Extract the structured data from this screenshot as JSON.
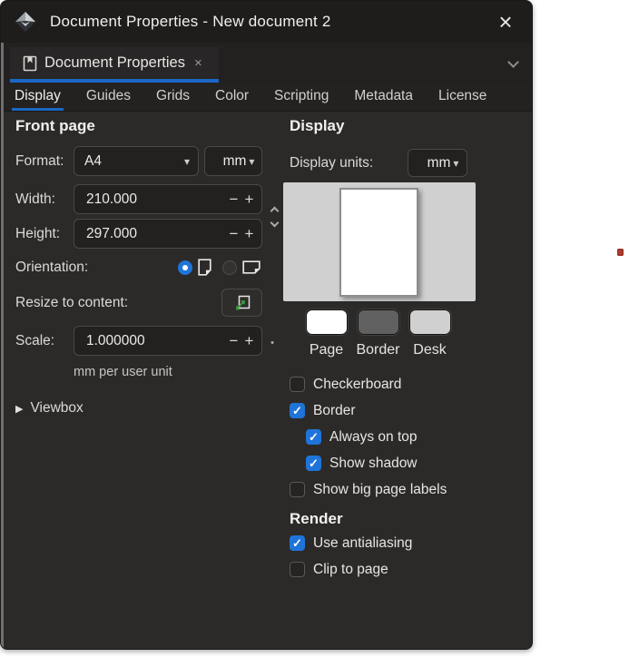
{
  "icons": {
    "window_close": "×",
    "tab_close": "×",
    "dropdown_arrow": "▾",
    "minus": "−",
    "plus": "+",
    "expander": "▶",
    "check": "✓",
    "scale_dot": "•"
  },
  "window": {
    "title": "Document Properties - New document 2"
  },
  "dock_tab": {
    "label": "Document Properties"
  },
  "tabs": [
    {
      "label": "Display",
      "active": true
    },
    {
      "label": "Guides",
      "active": false
    },
    {
      "label": "Grids",
      "active": false
    },
    {
      "label": "Color",
      "active": false
    },
    {
      "label": "Scripting",
      "active": false
    },
    {
      "label": "Metadata",
      "active": false
    },
    {
      "label": "License",
      "active": false
    }
  ],
  "front_page": {
    "heading": "Front page",
    "format_label": "Format:",
    "format_value": "A4",
    "unit_value": "mm",
    "width_label": "Width:",
    "width_value": "210.000",
    "height_label": "Height:",
    "height_value": "297.000",
    "orientation_label": "Orientation:",
    "resize_label": "Resize to content:",
    "scale_label": "Scale:",
    "scale_value": "1.000000",
    "scale_note": "mm per user unit",
    "viewbox_label": "Viewbox"
  },
  "display": {
    "heading": "Display",
    "units_label": "Display units:",
    "units_value": "mm",
    "colors": {
      "accent_blue": "#1f74d9",
      "tab_underline_blue": "#1b67c5",
      "desk": "#d0d0d0",
      "page": "#ffffff",
      "page_border": "#8d8d8d"
    },
    "swatches": [
      {
        "label": "Page",
        "color": "#ffffff"
      },
      {
        "label": "Border",
        "color": "#606060"
      },
      {
        "label": "Desk",
        "color": "#d0d0d0"
      }
    ],
    "checkboxes": [
      {
        "label": "Checkerboard",
        "checked": false,
        "indent": false
      },
      {
        "label": "Border",
        "checked": true,
        "indent": false
      },
      {
        "label": "Always on top",
        "checked": true,
        "indent": true
      },
      {
        "label": "Show shadow",
        "checked": true,
        "indent": true
      },
      {
        "label": "Show big page labels",
        "checked": false,
        "indent": false
      }
    ]
  },
  "render": {
    "heading": "Render",
    "checkboxes": [
      {
        "label": "Use antialiasing",
        "checked": true
      },
      {
        "label": "Clip to page",
        "checked": false
      }
    ]
  }
}
